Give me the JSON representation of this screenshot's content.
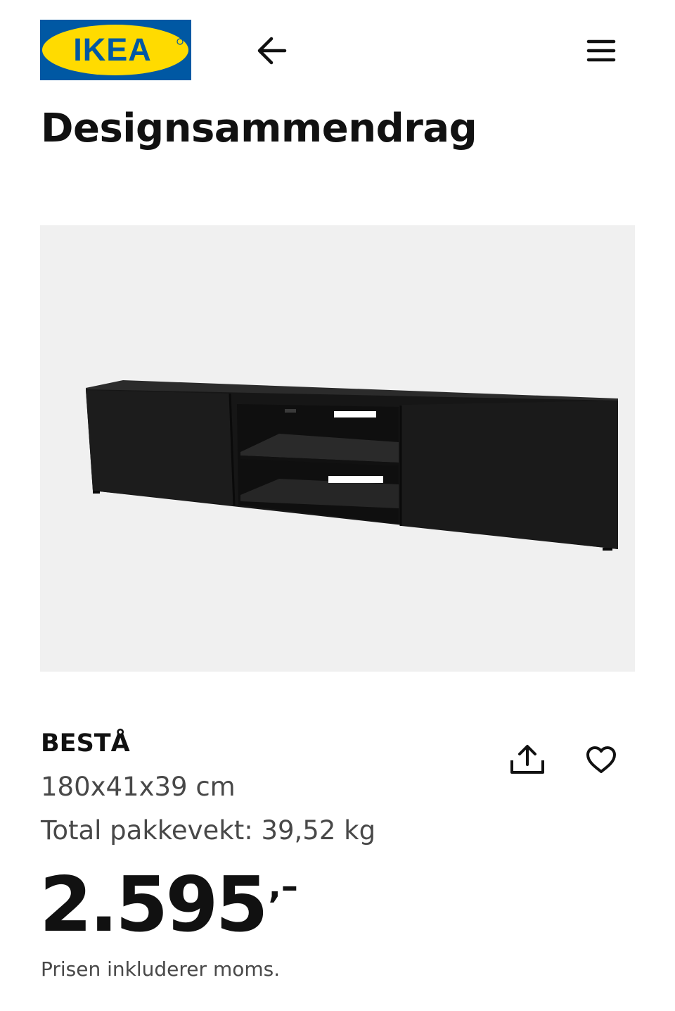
{
  "header": {
    "logo_text": "IKEA",
    "back_icon": "arrow-left-icon",
    "menu_icon": "hamburger-menu-icon"
  },
  "page": {
    "title": "Designsammendrag"
  },
  "product": {
    "image_icon": "tv-bench-image",
    "name": "BESTÅ",
    "dimensions": "180x41x39 cm",
    "package_weight": "Total pakkevekt: 39,52 kg",
    "price_integer": "2.595",
    "price_decimal": ",–",
    "price_note": "Prisen inkluderer moms.",
    "share_icon": "share-icon",
    "favourite_icon": "heart-icon"
  },
  "colors": {
    "ikea_blue": "#0058A3",
    "ikea_yellow": "#FFDB00",
    "text_primary": "#111111",
    "text_secondary": "#484848",
    "image_background": "#F0F0F0"
  }
}
